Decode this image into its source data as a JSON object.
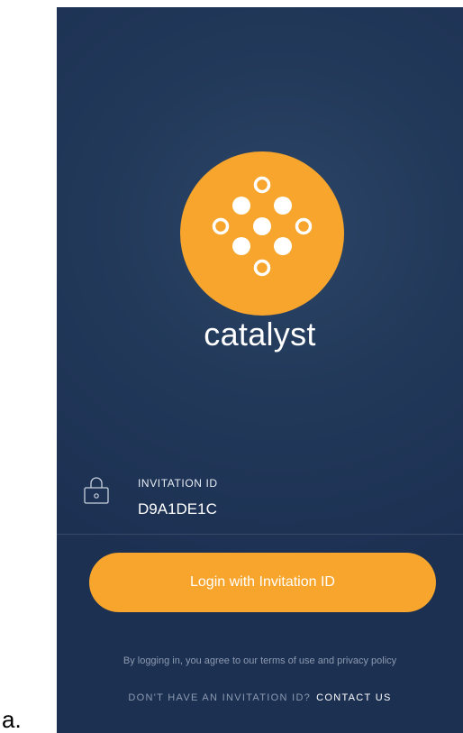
{
  "figure_label": "a.",
  "app": {
    "brand_name": "catalyst",
    "brand_color": "#f7a52c",
    "background_color": "#1e3254",
    "logo_icon": "catalyst-molecule-logo"
  },
  "invitation": {
    "icon": "lock-icon",
    "label": "INVITATION ID",
    "value": "D9A1DE1C"
  },
  "login_button": {
    "label": "Login with Invitation ID"
  },
  "terms_text": "By logging in, you agree to our terms of use and privacy policy",
  "signup": {
    "question": "DON'T HAVE AN INVITATION ID?",
    "contact_label": "CONTACT US"
  }
}
